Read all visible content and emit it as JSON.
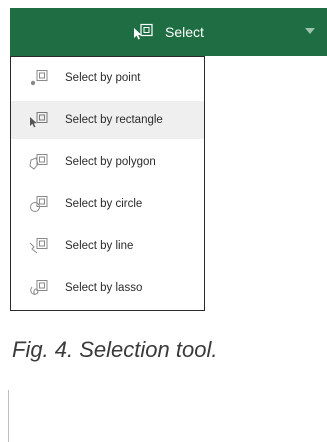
{
  "toolbar": {
    "title": "Select",
    "icon": "select-rectangle-icon",
    "dropdown_icon": "chevron-down-icon",
    "colors": {
      "background": "#1f6e43",
      "text": "#ffffff"
    }
  },
  "menu": {
    "items": [
      {
        "label": "Select by point",
        "icon": "select-point-icon",
        "active": false
      },
      {
        "label": "Select by rectangle",
        "icon": "select-rectangle-icon",
        "active": true
      },
      {
        "label": "Select by polygon",
        "icon": "select-polygon-icon",
        "active": false
      },
      {
        "label": "Select by circle",
        "icon": "select-circle-icon",
        "active": false
      },
      {
        "label": "Select by line",
        "icon": "select-line-icon",
        "active": false
      },
      {
        "label": "Select by lasso",
        "icon": "select-lasso-icon",
        "active": false
      }
    ]
  },
  "caption": "Fig. 4. Selection tool."
}
